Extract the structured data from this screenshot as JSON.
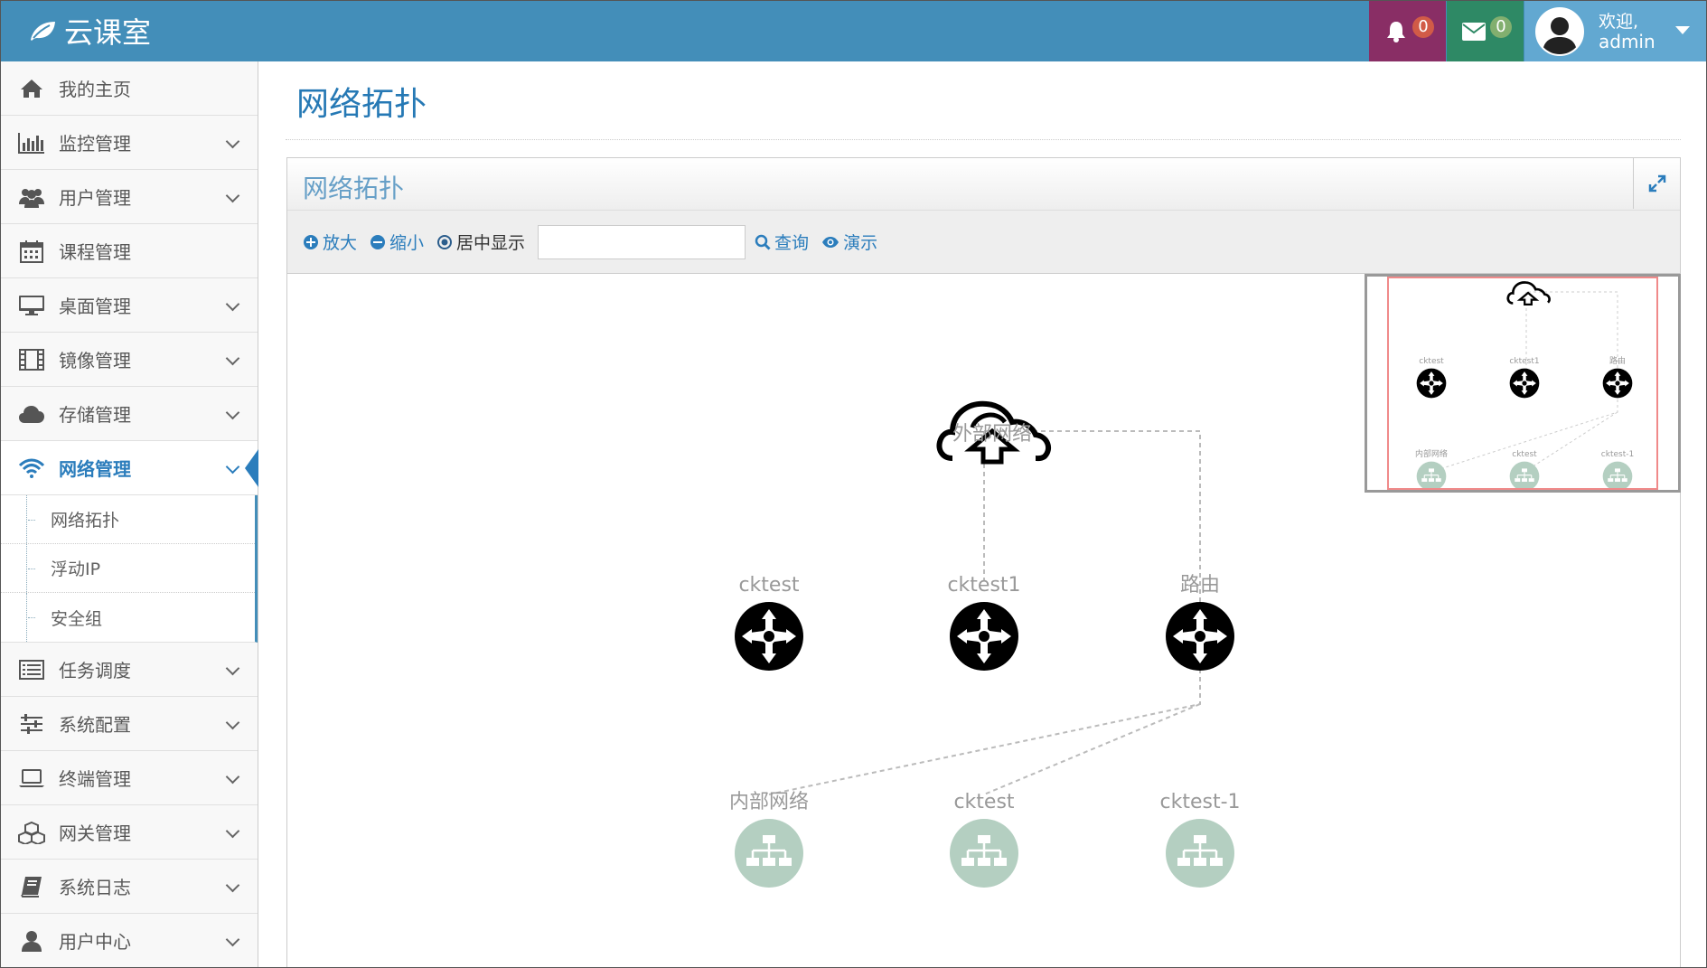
{
  "brand": {
    "name": "云课室"
  },
  "header": {
    "notifications_count": "0",
    "messages_count": "0",
    "welcome": "欢迎,",
    "username": "admin"
  },
  "sidebar": {
    "items": [
      {
        "label": "我的主页",
        "icon": "home-icon"
      },
      {
        "label": "监控管理",
        "icon": "bar-chart-icon"
      },
      {
        "label": "用户管理",
        "icon": "users-icon"
      },
      {
        "label": "课程管理",
        "icon": "calendar-icon"
      },
      {
        "label": "桌面管理",
        "icon": "desktop-icon"
      },
      {
        "label": "镜像管理",
        "icon": "film-icon"
      },
      {
        "label": "存储管理",
        "icon": "cloud-icon"
      },
      {
        "label": "网络管理",
        "icon": "wifi-icon"
      },
      {
        "label": "任务调度",
        "icon": "list-icon"
      },
      {
        "label": "系统配置",
        "icon": "sliders-icon"
      },
      {
        "label": "终端管理",
        "icon": "laptop-icon"
      },
      {
        "label": "网关管理",
        "icon": "cubes-icon"
      },
      {
        "label": "系统日志",
        "icon": "book-icon"
      },
      {
        "label": "用户中心",
        "icon": "user-icon"
      }
    ],
    "submenu": [
      {
        "label": "网络拓扑"
      },
      {
        "label": "浮动IP"
      },
      {
        "label": "安全组"
      }
    ]
  },
  "page": {
    "title": "网络拓扑"
  },
  "panel": {
    "title": "网络拓扑",
    "toolbar": {
      "zoom_in": "放大",
      "zoom_out": "缩小",
      "center": "居中显示",
      "search_value": "",
      "search_label": "查询",
      "demo_label": "演示"
    }
  },
  "topology": {
    "external": {
      "label": "外部网络"
    },
    "routers": [
      {
        "label": "cktest"
      },
      {
        "label": "cktest1"
      },
      {
        "label": "路由"
      }
    ],
    "networks": [
      {
        "label": "内部网络"
      },
      {
        "label": "cktest"
      },
      {
        "label": "cktest-1"
      }
    ]
  },
  "colors": {
    "topbar": "#438eb9",
    "bell_box": "#892e65",
    "mail_box": "#2e8965",
    "user_box": "#62a8d1",
    "accent": "#2b7dbc",
    "network_node": "#b4cfc1"
  }
}
